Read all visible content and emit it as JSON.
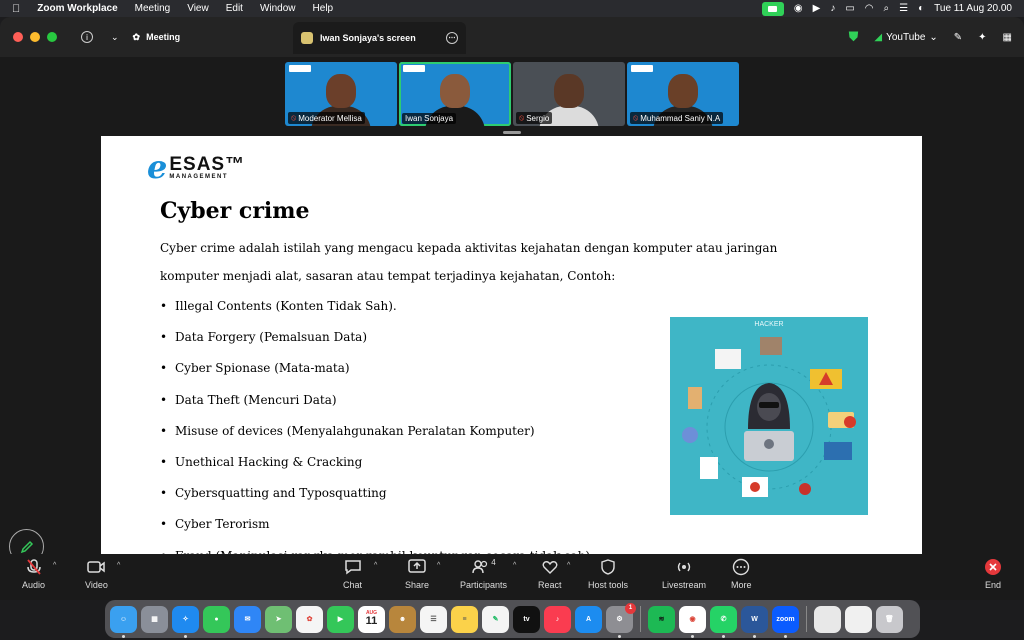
{
  "menubar": {
    "app_name": "Zoom Workplace",
    "menus": [
      "Meeting",
      "View",
      "Edit",
      "Window",
      "Help"
    ],
    "datetime": "Tue 11 Aug  20.00"
  },
  "titlebar": {
    "meeting_label": "Meeting",
    "share_tab_label": "Iwan Sonjaya's screen",
    "youtube_label": "YouTube"
  },
  "participants": [
    {
      "name": "Moderator Mellisa",
      "muted": true
    },
    {
      "name": "Iwan Sonjaya",
      "muted": false,
      "active": true
    },
    {
      "name": "Sergio",
      "muted": true
    },
    {
      "name": "Muhammad Saniy N.A",
      "muted": true
    }
  ],
  "slide": {
    "logo_brand": "ESAS™",
    "logo_sub": "MANAGEMENT",
    "title": "Cyber crime",
    "intro_line1": "Cyber crime adalah istilah yang mengacu kepada aktivitas  kejahatan dengan komputer atau jaringan",
    "intro_line2": "komputer menjadi alat,  sasaran atau tempat terjadinya kejahatan, Contoh:",
    "bullets": [
      "Illegal Contents (Konten Tidak Sah).",
      "Data Forgery (Pemalsuan Data)",
      "Cyber Spionase (Mata-mata)",
      "Data Theft (Mencuri Data)",
      "Misuse of devices (Menyalahgunakan Peralatan Komputer)",
      "Unethical Hacking & Cracking",
      "Cybersquatting and Typosquatting",
      "Cyber Terorism",
      "Fraud (Manipulasi rangka mengambil keuntungan secara tidak sah)"
    ],
    "image_label": "HACKER"
  },
  "toolbar": {
    "audio": "Audio",
    "video": "Video",
    "chat": "Chat",
    "share": "Share",
    "participants": "Participants",
    "participants_count": "4",
    "react": "React",
    "host_tools": "Host tools",
    "livestream": "Livestream",
    "more": "More",
    "end": "End"
  },
  "dock": {
    "calendar_month": "AUG",
    "calendar_day": "11",
    "tv_label": "tv",
    "zoom_label": "zoom",
    "settings_badge": "1",
    "word_label": "W"
  },
  "colors": {
    "accent_green": "#30d158",
    "zoom_blue": "#0b5cff",
    "slide_bg": "#ffffff",
    "hacker_bg": "#3fb6c6",
    "end_red": "#e5383b"
  }
}
